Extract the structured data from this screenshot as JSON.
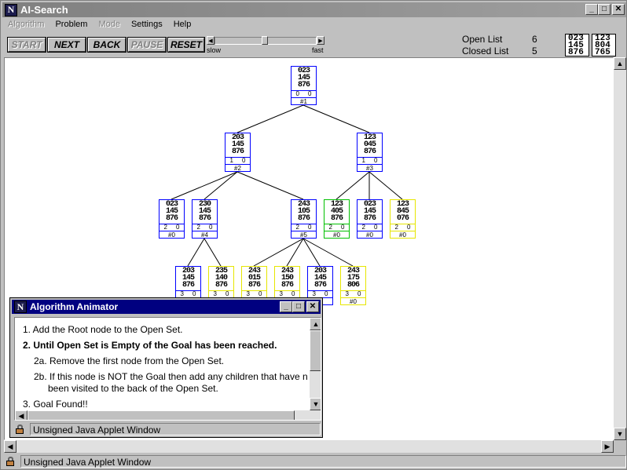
{
  "window": {
    "title": "AI-Search",
    "minimize": "_",
    "maximize": "□",
    "close": "✕"
  },
  "menu": [
    {
      "label": "Algorithm",
      "enabled": false
    },
    {
      "label": "Problem",
      "enabled": true
    },
    {
      "label": "Mode",
      "enabled": false
    },
    {
      "label": "Settings",
      "enabled": true
    },
    {
      "label": "Help",
      "enabled": true
    }
  ],
  "toolbar": {
    "start": "START",
    "next": "NEXT",
    "back": "BACK",
    "pause": "PAUSE",
    "reset": "RESET",
    "slider_slow": "slow",
    "slider_fast": "fast"
  },
  "stats": {
    "open_label": "Open List",
    "open_value": "6",
    "closed_label": "Closed List",
    "closed_value": "5"
  },
  "mini_boards": [
    [
      "023",
      "145",
      "876"
    ],
    [
      "123",
      "804",
      "765"
    ]
  ],
  "tree": {
    "nodes": [
      {
        "id": "n1",
        "rows": [
          "023",
          "145",
          "876"
        ],
        "g": "0",
        "h": "0",
        "label": "#1",
        "color": "blue"
      },
      {
        "id": "n2",
        "rows": [
          "203",
          "145",
          "876"
        ],
        "g": "1",
        "h": "0",
        "label": "#2",
        "color": "blue"
      },
      {
        "id": "n3",
        "rows": [
          "123",
          "045",
          "876"
        ],
        "g": "1",
        "h": "0",
        "label": "#3",
        "color": "blue"
      },
      {
        "id": "n4",
        "rows": [
          "023",
          "145",
          "876"
        ],
        "g": "2",
        "h": "0",
        "label": "#0",
        "color": "blue"
      },
      {
        "id": "n5",
        "rows": [
          "230",
          "145",
          "876"
        ],
        "g": "2",
        "h": "0",
        "label": "#4",
        "color": "blue"
      },
      {
        "id": "n6",
        "rows": [
          "243",
          "105",
          "876"
        ],
        "g": "2",
        "h": "0",
        "label": "#5",
        "color": "blue"
      },
      {
        "id": "n7",
        "rows": [
          "123",
          "405",
          "876"
        ],
        "g": "2",
        "h": "0",
        "label": "#0",
        "color": "green"
      },
      {
        "id": "n8",
        "rows": [
          "023",
          "145",
          "876"
        ],
        "g": "2",
        "h": "0",
        "label": "#0",
        "color": "blue"
      },
      {
        "id": "n9",
        "rows": [
          "123",
          "845",
          "076"
        ],
        "g": "2",
        "h": "0",
        "label": "#0",
        "color": "yellow"
      },
      {
        "id": "n10",
        "rows": [
          "203",
          "145",
          "876"
        ],
        "g": "3",
        "h": "0",
        "label": "",
        "color": "blue"
      },
      {
        "id": "n11",
        "rows": [
          "235",
          "140",
          "876"
        ],
        "g": "3",
        "h": "0",
        "label": "",
        "color": "yellow"
      },
      {
        "id": "n12",
        "rows": [
          "243",
          "015",
          "876"
        ],
        "g": "3",
        "h": "0",
        "label": "",
        "color": "yellow"
      },
      {
        "id": "n13",
        "rows": [
          "243",
          "150",
          "876"
        ],
        "g": "3",
        "h": "0",
        "label": "",
        "color": "yellow"
      },
      {
        "id": "n14",
        "rows": [
          "203",
          "145",
          "876"
        ],
        "g": "3",
        "h": "0",
        "label": "",
        "color": "blue"
      },
      {
        "id": "n15",
        "rows": [
          "243",
          "175",
          "806"
        ],
        "g": "3",
        "h": "0",
        "label": "#0",
        "color": "yellow"
      }
    ]
  },
  "animator": {
    "title": "Algorithm Animator",
    "steps": [
      {
        "text": "1. Add the Root node to the Open Set.",
        "bold": false
      },
      {
        "text": "2. Until Open Set is Empty of the Goal has been reached.",
        "bold": true
      },
      {
        "text": "2a. Remove the first node from the Open Set.",
        "bold": false
      },
      {
        "text": "2b. If this node is NOT the Goal then add any children that have n",
        "bold": false
      },
      {
        "text": "been visited to the back of the Open Set.",
        "bold": false
      },
      {
        "text": "3. Goal Found!!",
        "bold": false
      }
    ],
    "status": "Unsigned Java Applet Window"
  },
  "status": "Unsigned Java Applet Window"
}
